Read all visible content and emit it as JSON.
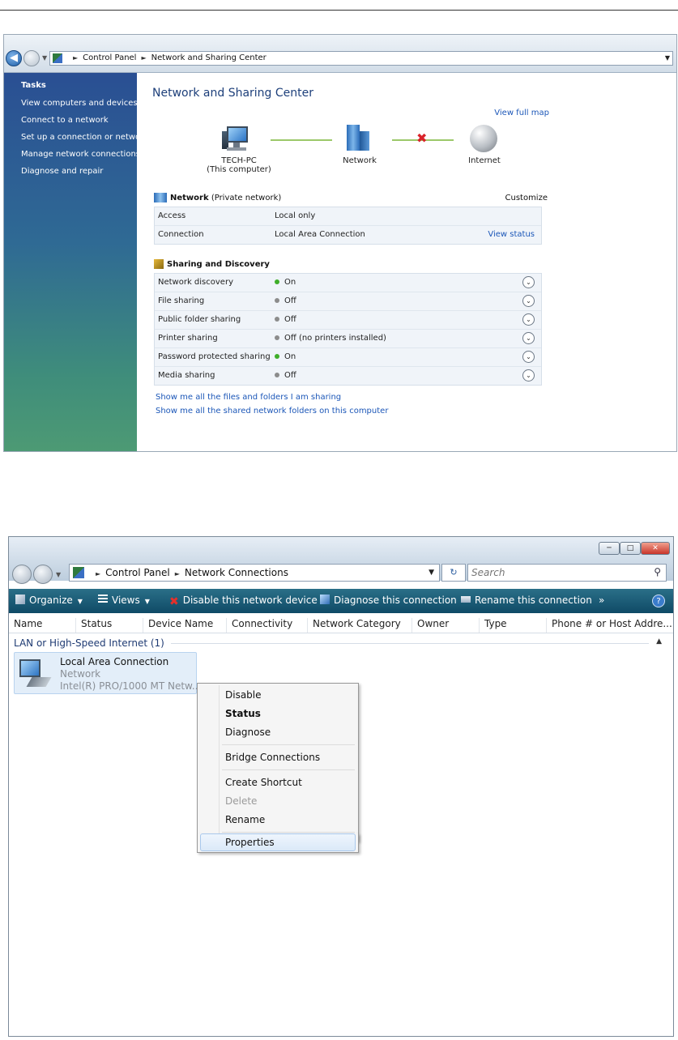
{
  "sharing_center": {
    "breadcrumb": [
      "Control Panel",
      "Network and Sharing Center"
    ],
    "tasks_header": "Tasks",
    "tasks": [
      "View computers and devices",
      "Connect to a network",
      "Set up a connection or network",
      "Manage network connections",
      "Diagnose and repair"
    ],
    "page_title": "Network and Sharing Center",
    "view_full_map": "View full map",
    "map": {
      "computer_name": "TECH-PC",
      "computer_sub": "(This computer)",
      "network_label": "Network",
      "internet_label": "Internet"
    },
    "network_section": {
      "title": "Network",
      "type": "(Private network)",
      "customize": "Customize",
      "rows": [
        {
          "label": "Access",
          "value": "Local only",
          "action": ""
        },
        {
          "label": "Connection",
          "value": "Local Area Connection",
          "action": "View status"
        }
      ]
    },
    "sharing_section": {
      "title": "Sharing and Discovery",
      "rows": [
        {
          "label": "Network discovery",
          "value": "On",
          "status": "on"
        },
        {
          "label": "File sharing",
          "value": "Off",
          "status": "off"
        },
        {
          "label": "Public folder sharing",
          "value": "Off",
          "status": "off"
        },
        {
          "label": "Printer sharing",
          "value": "Off (no printers installed)",
          "status": "off"
        },
        {
          "label": "Password protected sharing",
          "value": "On",
          "status": "on"
        },
        {
          "label": "Media sharing",
          "value": "Off",
          "status": "off"
        }
      ]
    },
    "links": [
      "Show me all the files and folders I am sharing",
      "Show me all the shared network folders on this computer"
    ]
  },
  "connections": {
    "breadcrumb": [
      "Control Panel",
      "Network Connections"
    ],
    "search_placeholder": "Search",
    "toolbar": {
      "organize": "Organize",
      "views": "Views",
      "disable": "Disable this network device",
      "diagnose": "Diagnose this connection",
      "rename": "Rename this connection",
      "more": "»",
      "help": "?"
    },
    "columns": [
      "Name",
      "Status",
      "Device Name",
      "Connectivity",
      "Network Category",
      "Owner",
      "Type",
      "Phone # or Host Addre..."
    ],
    "group": "LAN or High-Speed Internet (1)",
    "item": {
      "name": "Local Area Connection",
      "status": "Network",
      "device": "Intel(R) PRO/1000 MT Netw..."
    },
    "context_menu": [
      "Disable",
      "Status",
      "Diagnose",
      "Bridge Connections",
      "Create Shortcut",
      "Delete",
      "Rename",
      "Properties"
    ]
  },
  "colors": {
    "on_dot": "#3fae2a",
    "off_dot": "#8c8c8c",
    "link": "#1c57b8",
    "toolbar": "#0f4a66"
  }
}
